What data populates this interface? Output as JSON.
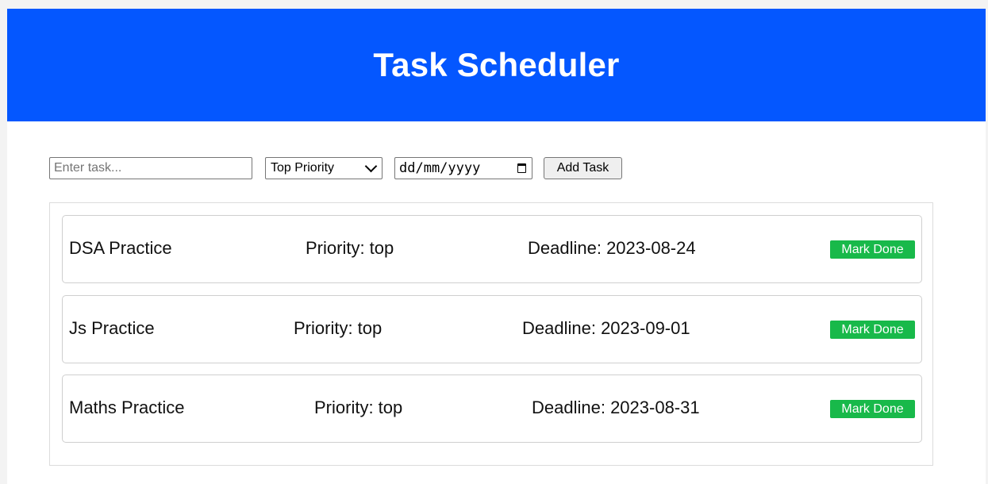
{
  "header": {
    "title": "Task Scheduler",
    "background_color": "#0457ff"
  },
  "controls": {
    "task_input": {
      "value": "",
      "placeholder": "Enter task..."
    },
    "priority_select": {
      "selected": "Top Priority"
    },
    "date_input": {
      "placeholder": "dd/mm/yyyy"
    },
    "add_button_label": "Add Task"
  },
  "tasks": [
    {
      "name": "DSA Practice",
      "priority": "Priority: top",
      "deadline": "Deadline: 2023-08-24",
      "action_label": "Mark Done"
    },
    {
      "name": "Js Practice",
      "priority": "Priority: top",
      "deadline": "Deadline: 2023-09-01",
      "action_label": "Mark Done"
    },
    {
      "name": "Maths Practice",
      "priority": "Priority: top",
      "deadline": "Deadline: 2023-08-31",
      "action_label": "Mark Done"
    }
  ],
  "colors": {
    "accent": "#0457ff",
    "done_button": "#18b94a"
  },
  "icons": {
    "select_arrow": "chevron-down-icon",
    "date_picker": "calendar-icon"
  }
}
